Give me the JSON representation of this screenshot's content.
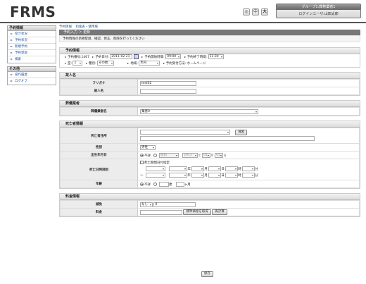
{
  "app": {
    "logo": "FRMS"
  },
  "header": {
    "font_small": "中",
    "font_large": "大",
    "font_back": "◎",
    "group": "グループ1:葬祭業者1",
    "user": "ログインユーザ:山田太郎"
  },
  "sidebar": {
    "sections": [
      {
        "title": "予約情報",
        "items": [
          "空き状況",
          "予約状況",
          "新規予約",
          "予約受取",
          "検索"
        ]
      },
      {
        "title": "その他",
        "items": [
          "操作履歴",
          "ログオフ"
        ]
      }
    ]
  },
  "breadcrumb": {
    "items": [
      "予約情報",
      "料金表・使用場"
    ]
  },
  "titlebar": "予約入力 ＞ 更新",
  "instruction": "予約情報の新規登録、確認、修正、削除を行ってください",
  "reservation": {
    "header": "予約情報",
    "number_label": "予約番号:1467",
    "date_label": "予約日付:",
    "date_value": "2011-02-21",
    "start_label": "予約開始時間:",
    "start_value": "09:00",
    "end_label": "予約終了時間:",
    "end_value": "11:30",
    "room_label": "室:",
    "room_value": "1",
    "type_label": "種別:",
    "type_value": "その他",
    "area_label": "地域:",
    "area_value": "市内",
    "method_label": "予約受付方法:",
    "method_value": "ホームページ"
  },
  "petitioner": {
    "header": "故人名",
    "furigana_label": "フリガナ",
    "furigana_value": "test02",
    "name_label": "故人名",
    "name_value": ""
  },
  "funeral": {
    "header": "葬儀業者",
    "name_label": "葬儀業者名",
    "name_value": "業者0"
  },
  "deceased": {
    "header": "死亡者情報",
    "address_label": "死亡者住所",
    "address_search": "検索",
    "sex_label": "性別",
    "sex_value": "男性",
    "birth_label": "出生年月日",
    "birth_unknown": "不詳",
    "era_value": "昭和",
    "birth_year": "1911",
    "birth_month": "01",
    "birth_day": "01",
    "u_year": "年",
    "u_month": "月",
    "u_day": "日",
    "death_label": "死亡日時刻別",
    "death_range": "死亡期間日付指定",
    "u_hour": "時",
    "u_min": "分",
    "tilde": "〜",
    "age_label": "年齢",
    "age_unknown": "不詳",
    "age_unit_year": "歳",
    "age_unit_month": "ヶ月"
  },
  "fee": {
    "header": "料金情報",
    "discount_label": "減免",
    "discount_value": "なし",
    "discount_amount": "0",
    "fee_label": "料金",
    "fee_calc_btn": "標準価格を取得",
    "recalc_btn": "再計算"
  },
  "actions": {
    "save": "保存"
  }
}
